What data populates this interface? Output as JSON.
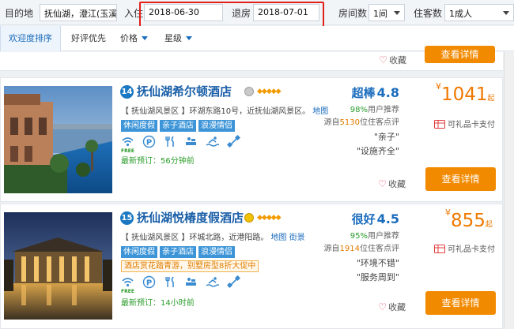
{
  "search": {
    "destination_label": "目的地",
    "destination_value": "抚仙湖，澄江(玉溪)",
    "checkin_label": "入住",
    "checkin_value": "2018-06-30",
    "checkout_label": "退房",
    "checkout_value": "2018-07-01",
    "rooms_label": "房间数",
    "rooms_value": "1间",
    "guests_label": "住客数",
    "guests_value": "1成人"
  },
  "sort": {
    "items": [
      {
        "label": "欢迎度排序",
        "active": true
      },
      {
        "label": "好评优先",
        "active": false
      },
      {
        "label": "价格",
        "active": false
      },
      {
        "label": "星级",
        "active": false
      }
    ]
  },
  "prev_card": {
    "fav_label": "收藏",
    "detail_button": "查看详情"
  },
  "hotels": [
    {
      "number": "14",
      "name": "抚仙湖希尔顿酒店",
      "address_prefix": "【 抚仙湖风景区 】",
      "address": "环湖东路10号，近抚仙湖风景区。",
      "map_link": "地图",
      "tags": [
        "休闲度假",
        "亲子酒店",
        "浪漫情侣"
      ],
      "free_label": "FREE",
      "last_booking": "最新预订：56分钟前",
      "rating_word": "超棒",
      "rating_score": "4.8",
      "recommend_pct": "98%",
      "recommend_suffix": "用户推荐",
      "reviews_prefix": "源自",
      "reviews_count": "5130",
      "reviews_suffix": "位住客点评",
      "quotes": [
        "\"亲子\"",
        "\"设施齐全\""
      ],
      "currency": "¥",
      "price": "1041",
      "price_suffix": "起",
      "gift_card": "可礼品卡支付",
      "fav_label": "收藏",
      "detail_button": "查看详情"
    },
    {
      "number": "15",
      "name": "抚仙湖悦椿度假酒店",
      "address_prefix": "【 抚仙湖风景区 】",
      "address": "环城北路，近港阳路。",
      "map_link": "地图",
      "street_link": "街景",
      "tags": [
        "休闲度假",
        "亲子酒店",
        "浪漫情侣"
      ],
      "promo": "酒店赏花踏青游，别墅房型8折大促中",
      "free_label": "FREE",
      "last_booking": "最新预订：14小时前",
      "rating_word": "很好",
      "rating_score": "4.5",
      "recommend_pct": "95%",
      "recommend_suffix": "用户推荐",
      "reviews_prefix": "源自",
      "reviews_count": "1914",
      "reviews_suffix": "位住客点评",
      "quotes": [
        "\"环境不错\"",
        "\"服务周到\""
      ],
      "currency": "¥",
      "price": "855",
      "price_suffix": "起",
      "gift_card": "可礼品卡支付",
      "fav_label": "收藏",
      "detail_button": "查看详情"
    }
  ],
  "icons": {
    "amenities": [
      "wifi-icon",
      "parking-icon",
      "restaurant-icon",
      "fitness-icon",
      "pool-icon",
      "gym-icon"
    ],
    "gift": "gift-card-icon",
    "fav": "heart-icon"
  },
  "colors": {
    "brand_blue": "#1a6cbd",
    "price_orange": "#f07800",
    "button_orange": "#f28a00",
    "tag_blue": "#3d95d8",
    "highlight_red": "#e0211a"
  }
}
